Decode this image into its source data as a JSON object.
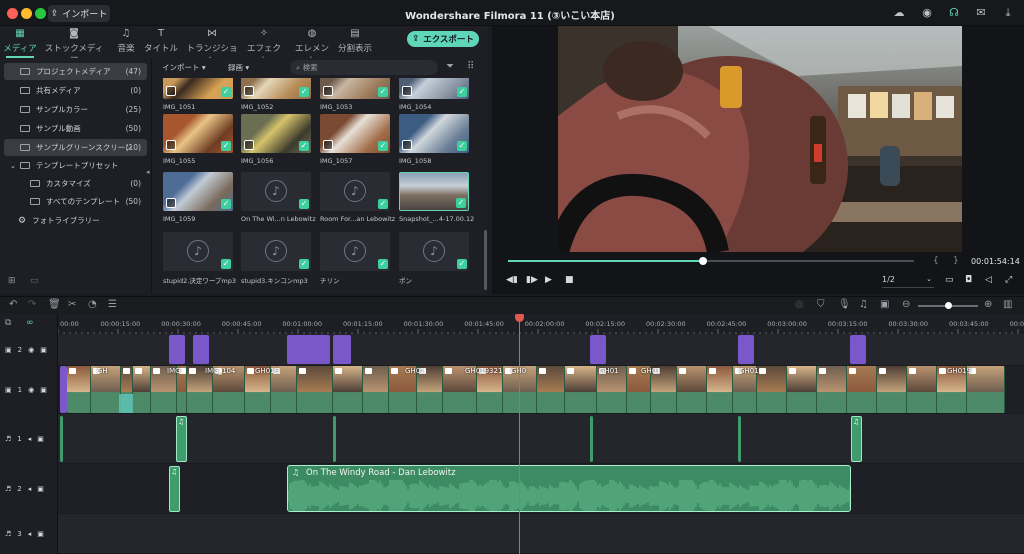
{
  "window": {
    "title": "Wondershare Filmora 11 (③いこい本店)",
    "import_button": "インポート"
  },
  "tabs": [
    {
      "label": "メディア",
      "icon": "media-icon"
    },
    {
      "label": "ストックメディア",
      "icon": "stock-media-icon"
    },
    {
      "label": "音楽",
      "icon": "music-icon"
    },
    {
      "label": "タイトル",
      "icon": "title-icon"
    },
    {
      "label": "トランジション",
      "icon": "transition-icon"
    },
    {
      "label": "エフェクト",
      "icon": "effect-icon"
    },
    {
      "label": "エレメント",
      "icon": "element-icon"
    },
    {
      "label": "分割表示",
      "icon": "split-screen-icon"
    }
  ],
  "export_button": "エクスポート",
  "sidebar": {
    "items": [
      {
        "label": "プロジェクトメディア",
        "count": "(47)"
      },
      {
        "label": "共有メディア",
        "count": "(0)"
      },
      {
        "label": "サンプルカラー",
        "count": "(25)"
      },
      {
        "label": "サンプル動画",
        "count": "(50)"
      },
      {
        "label": "サンプルグリーンスクリーン",
        "count": "(10)"
      },
      {
        "label": "テンプレートプリセット",
        "count": ""
      },
      {
        "label": "カスタマイズ",
        "count": "(0)"
      },
      {
        "label": "すべてのテンプレート",
        "count": "(50)"
      },
      {
        "label": "フォトライブラリー",
        "count": ""
      }
    ]
  },
  "media_toolbar": {
    "import_dropdown": "インポート",
    "record_dropdown": "録画",
    "search_placeholder": "検索"
  },
  "media": [
    {
      "name": "IMG_1051",
      "type": "video"
    },
    {
      "name": "IMG_1052",
      "type": "video"
    },
    {
      "name": "IMG_1053",
      "type": "video"
    },
    {
      "name": "IMG_1054",
      "type": "video"
    },
    {
      "name": "IMG_1055",
      "type": "video"
    },
    {
      "name": "IMG_1056",
      "type": "video"
    },
    {
      "name": "IMG_1057",
      "type": "video"
    },
    {
      "name": "IMG_1058",
      "type": "video"
    },
    {
      "name": "IMG_1059",
      "type": "video"
    },
    {
      "name": "On The Wi...n Lebowitz",
      "type": "audio"
    },
    {
      "name": "Room For...an Lebowitz",
      "type": "audio"
    },
    {
      "name": "Snapshot_...4-17.00.12",
      "type": "snapshot"
    },
    {
      "name": "stupid2.決定ワープmp3",
      "type": "audio"
    },
    {
      "name": "stupid3.キンコンmp3",
      "type": "audio"
    },
    {
      "name": "チリン",
      "type": "audio"
    },
    {
      "name": "ポン",
      "type": "audio"
    }
  ],
  "player": {
    "timecode": "00:01:54:14",
    "quality": "1/2",
    "progress": 0.48
  },
  "ruler": [
    "00:00",
    "00:00:15:00",
    "00:00:30:00",
    "00:00:45:00",
    "00:01:00:00",
    "00:01:15:00",
    "00:01:30:00",
    "00:01:45:00",
    "00:02:00:00",
    "00:02:15:00",
    "00:02:30:00",
    "00:02:45:00",
    "00:03:00:00",
    "00:03:15:00",
    "00:03:30:00",
    "00:03:45:00",
    "00:0"
  ],
  "tracks": [
    {
      "label": "2",
      "kind": "video"
    },
    {
      "label": "1",
      "kind": "video"
    },
    {
      "label": "1",
      "kind": "audio"
    },
    {
      "label": "2",
      "kind": "audio"
    },
    {
      "label": "3",
      "kind": "audio"
    }
  ],
  "clip_labels": [
    "GH",
    "IMG",
    "IMG_104",
    "GH019",
    "GH01",
    "GH019321",
    "GH0",
    "GH01",
    "GH01",
    "GH01",
    "GH019"
  ],
  "music_clip": {
    "label": "On The Windy Road - Dan Lebowitz"
  },
  "colors": {
    "accent": "#5ed6b7",
    "playhead": "#e05a4f",
    "title_clip": "#7a58c9",
    "audio_clip": "#3f9c6c"
  }
}
